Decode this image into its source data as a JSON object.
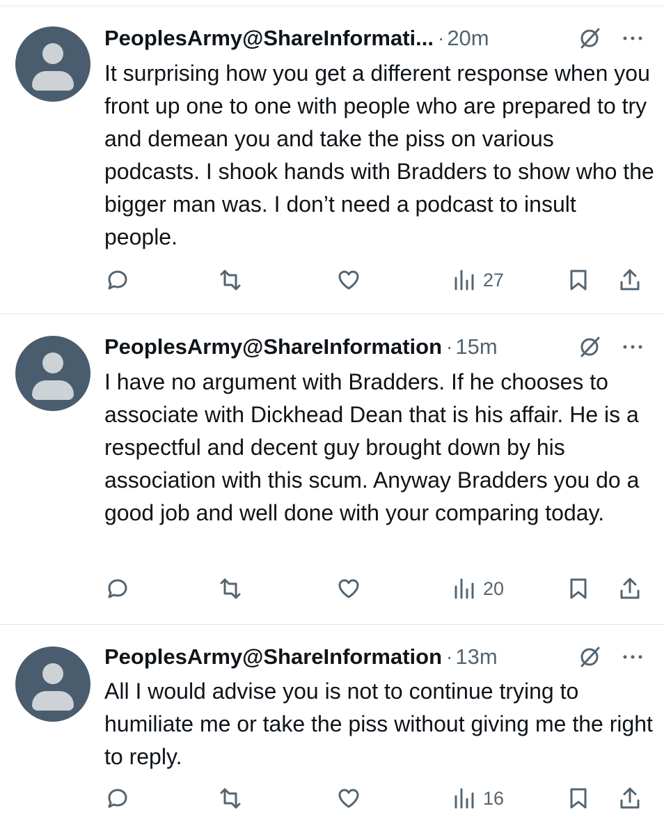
{
  "tweets": [
    {
      "display_name": "PeoplesArmy@ShareInformati...",
      "time": "20m",
      "text": "It surprising how you get a different response when you front up one to one with people who are prepared to try and demean you and take the piss on various podcasts. I shook hands with  Bradders to show who the bigger man was. I don’t need a podcast to insult people.",
      "views": "27"
    },
    {
      "display_name": "PeoplesArmy@ShareInformation",
      "time": "15m",
      "text": "I have no argument with Bradders.  If he chooses to associate with Dickhead  Dean  that is his affair. He is a respectful and decent guy brought down by his association  with this scum. Anyway Bradders you do a good job and well done with your comparing today.",
      "views": "20"
    },
    {
      "display_name": "PeoplesArmy@ShareInformation",
      "time": "13m",
      "text": "All I would advise you is not to continue trying to humiliate me or take the piss without giving me the right to reply.",
      "views": "16"
    }
  ],
  "separator": "·",
  "icons": {
    "reply": "reply-icon",
    "retweet": "retweet-icon",
    "like": "like-icon",
    "views": "views-icon",
    "bookmark": "bookmark-icon",
    "share": "share-icon",
    "muted": "muted-icon",
    "more": "more-icon"
  },
  "colors": {
    "text": "#0f1419",
    "secondary": "#536471",
    "avatar_bg": "#4a5d6e",
    "avatar_fg": "#cdd2d7",
    "divider": "#e1e6ea"
  }
}
